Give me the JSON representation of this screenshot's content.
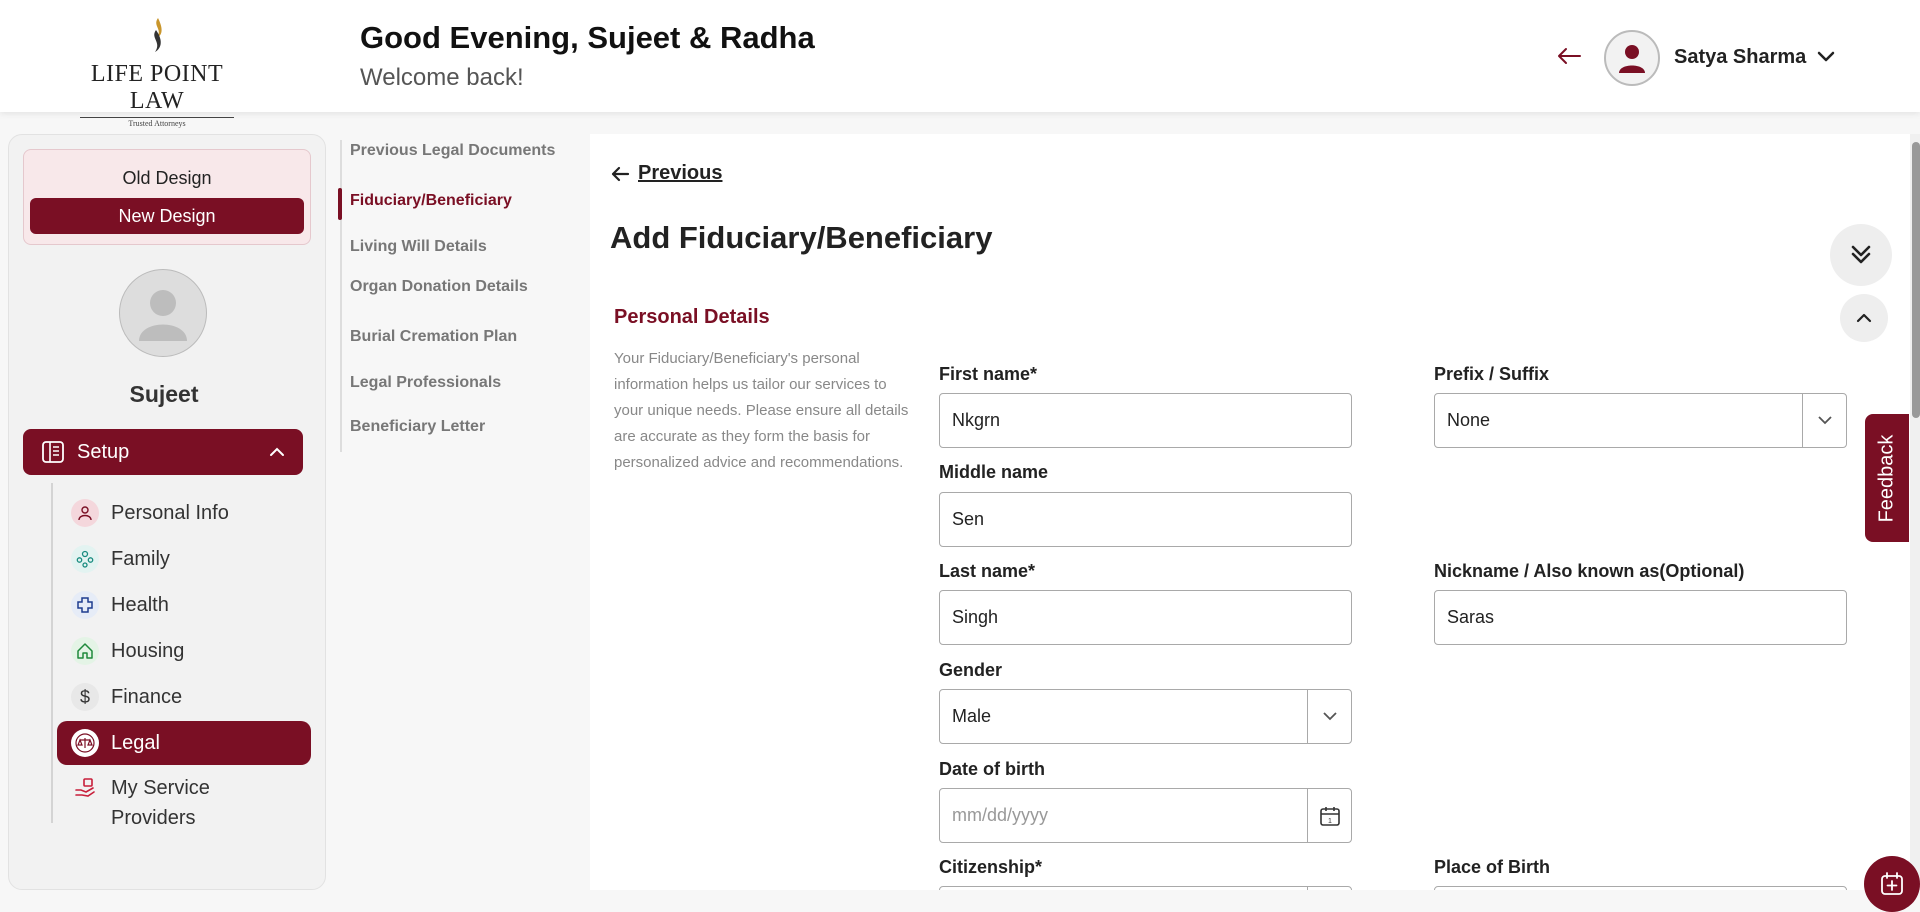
{
  "brand": {
    "name": "LIFE POINT LAW",
    "tagline": "Trusted Attorneys"
  },
  "header": {
    "greeting": "Good Evening, Sujeet & Radha",
    "subtitle": "Welcome back!",
    "user_name": "Satya Sharma"
  },
  "sidebar": {
    "old_design": "Old Design",
    "new_design": "New Design",
    "profile_name": "Sujeet",
    "setup_label": "Setup",
    "items": [
      {
        "label": "Personal Info",
        "icon": "person-icon"
      },
      {
        "label": "Family",
        "icon": "family-icon"
      },
      {
        "label": "Health",
        "icon": "health-cross-icon"
      },
      {
        "label": "Housing",
        "icon": "home-icon"
      },
      {
        "label": "Finance",
        "icon": "dollar-icon"
      },
      {
        "label": "Legal",
        "icon": "scales-icon",
        "active": true
      },
      {
        "label": "My Service Providers",
        "icon": "service-hand-icon"
      }
    ]
  },
  "subnav": {
    "items": [
      {
        "label": "Previous Legal Documents"
      },
      {
        "label": "Fiduciary/Beneficiary",
        "active": true
      },
      {
        "label": "Living Will Details"
      },
      {
        "label": "Organ Donation Details"
      },
      {
        "label": "Burial Cremation Plan"
      },
      {
        "label": "Legal Professionals"
      },
      {
        "label": "Beneficiary Letter"
      }
    ]
  },
  "main": {
    "previous_label": "Previous",
    "title": "Add Fiduciary/Beneficiary",
    "section_title": "Personal Details",
    "section_desc": "Your Fiduciary/Beneficiary's personal information helps us tailor our services to your unique needs. Please ensure all details are accurate as they form the basis for personalized advice and recommendations.",
    "fields": {
      "first_name": {
        "label": "First name*",
        "value": "Nkgrn"
      },
      "prefix_suffix": {
        "label": "Prefix / Suffix",
        "value": "None"
      },
      "middle_name": {
        "label": "Middle name",
        "value": "Sen"
      },
      "last_name": {
        "label": "Last name*",
        "value": "Singh"
      },
      "nickname": {
        "label": "Nickname / Also known as(Optional)",
        "value": "Saras"
      },
      "gender": {
        "label": "Gender",
        "value": "Male"
      },
      "dob": {
        "label": "Date of birth",
        "placeholder": "mm/dd/yyyy"
      },
      "citizenship": {
        "label": "Citizenship*"
      },
      "place_of_birth": {
        "label": "Place of Birth"
      }
    }
  },
  "feedback_label": "Feedback",
  "colors": {
    "accent": "#7a0f24",
    "accent_light": "#f8e8ea"
  }
}
